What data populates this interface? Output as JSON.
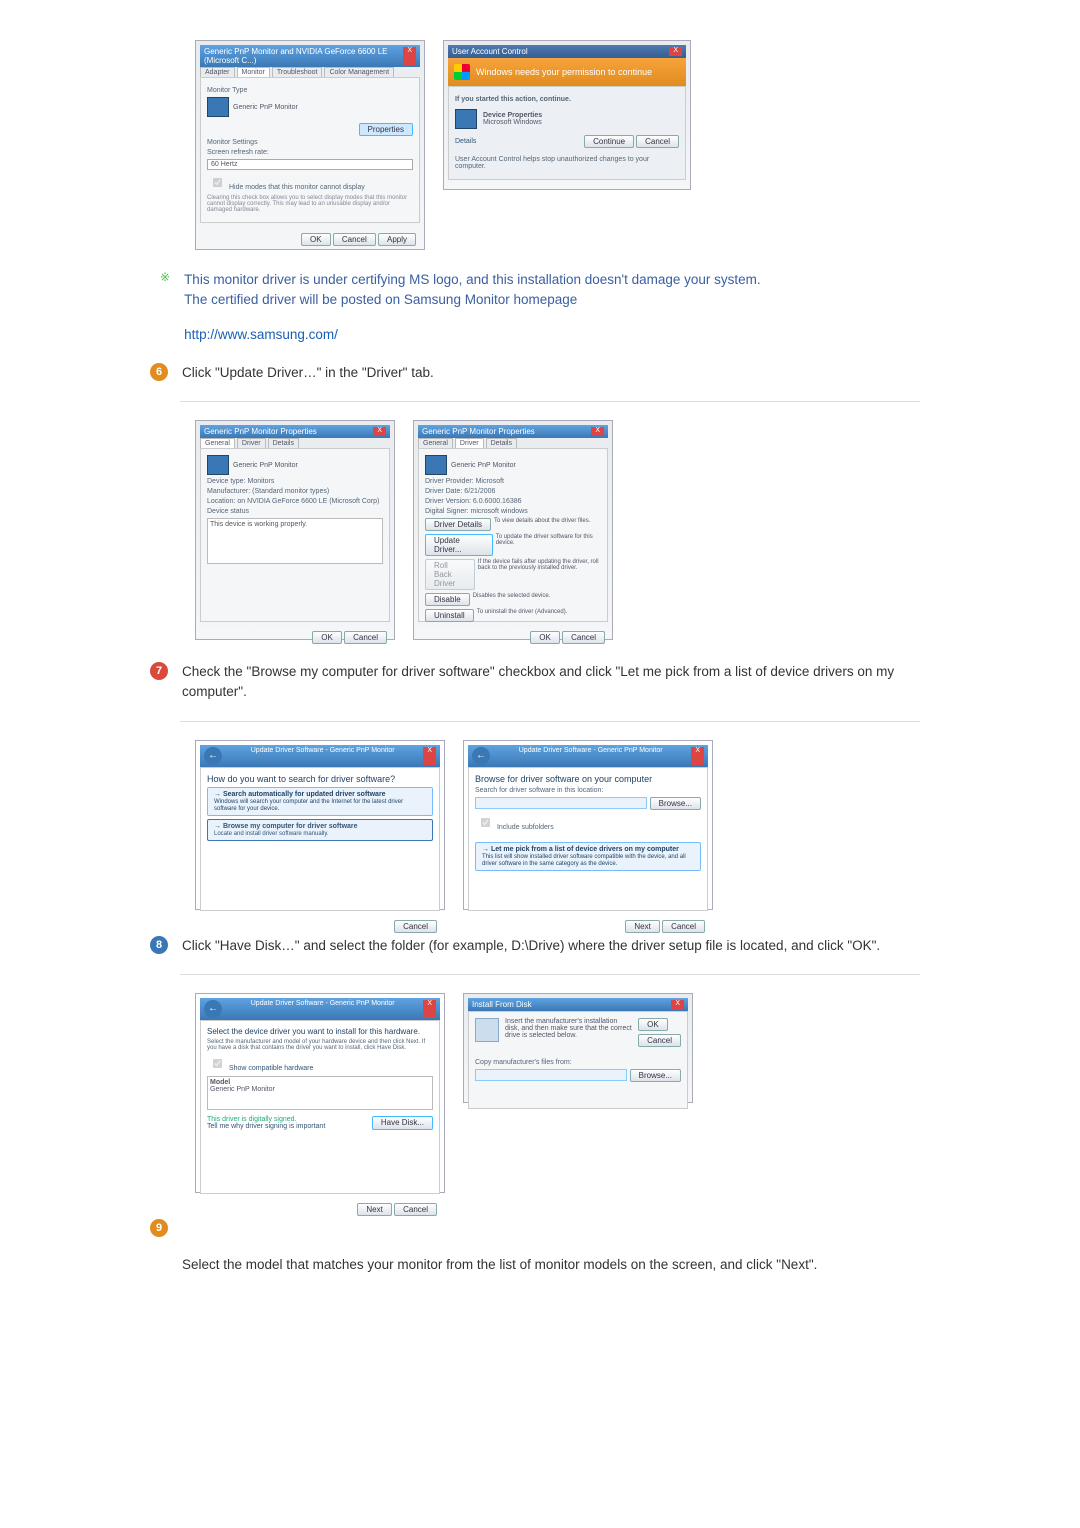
{
  "properties1": {
    "title": "Generic PnP Monitor and NVIDIA GeForce 6600 LE (Microsoft C...)",
    "tabs": [
      "Adapter",
      "Monitor",
      "Troubleshoot",
      "Color Management"
    ],
    "monitor_type_label": "Monitor Type",
    "monitor_type_value": "Generic PnP Monitor",
    "properties_btn": "Properties",
    "monitor_settings_label": "Monitor Settings",
    "refresh_label": "Screen refresh rate:",
    "refresh_value": "60 Hertz",
    "hide_checkbox": "Hide modes that this monitor cannot display",
    "hide_note": "Clearing this check box allows you to select display modes that this monitor cannot display correctly. This may lead to an unusable display and/or damaged hardware.",
    "ok": "OK",
    "cancel": "Cancel",
    "apply": "Apply"
  },
  "uac": {
    "title": "User Account Control",
    "banner": "Windows needs your permission to continue",
    "started_label": "If you started this action, continue.",
    "item_title": "Device Properties",
    "item_pub": "Microsoft Windows",
    "details": "Details",
    "continue": "Continue",
    "cancel": "Cancel",
    "footer": "User Account Control helps stop unauthorized changes to your computer."
  },
  "note": {
    "line1": "This monitor driver is under certifying MS logo, and this installation doesn't damage your system.",
    "line2": "The certified driver will be posted on Samsung Monitor homepage",
    "link": "http://www.samsung.com/"
  },
  "step6": {
    "text": "Click \"Update Driver…\" in the \"Driver\" tab."
  },
  "pnp_general": {
    "title": "Generic PnP Monitor Properties",
    "tabs": [
      "General",
      "Driver",
      "Details"
    ],
    "name": "Generic PnP Monitor",
    "devtype_l": "Device type:",
    "devtype_v": "Monitors",
    "manu_l": "Manufacturer:",
    "manu_v": "(Standard monitor types)",
    "loc_l": "Location:",
    "loc_v": "on NVIDIA GeForce 6600 LE (Microsoft Corp)",
    "status_l": "Device status",
    "status_v": "This device is working properly.",
    "ok": "OK",
    "cancel": "Cancel"
  },
  "pnp_driver": {
    "title": "Generic PnP Monitor Properties",
    "name": "Generic PnP Monitor",
    "provider_l": "Driver Provider:",
    "provider_v": "Microsoft",
    "date_l": "Driver Date:",
    "date_v": "6/21/2006",
    "ver_l": "Driver Version:",
    "ver_v": "6.0.6000.16386",
    "signer_l": "Digital Signer:",
    "signer_v": "microsoft windows",
    "btn_details": "Driver Details",
    "btn_update": "Update Driver...",
    "btn_rollback": "Roll Back Driver",
    "btn_disable": "Disable",
    "btn_uninstall": "Uninstall",
    "d_details": "To view details about the driver files.",
    "d_update": "To update the driver software for this device.",
    "d_rollback": "If the device fails after updating the driver, roll back to the previously installed driver.",
    "d_disable": "Disables the selected device.",
    "d_uninstall": "To uninstall the driver (Advanced).",
    "ok": "OK",
    "cancel": "Cancel"
  },
  "step7": {
    "text": "Check the \"Browse my computer for driver software\" checkbox and click \"Let me pick from a list of device drivers on my computer\"."
  },
  "wizard1": {
    "title": "Update Driver Software - Generic PnP Monitor",
    "heading": "How do you want to search for driver software?",
    "opt1_t": "Search automatically for updated driver software",
    "opt1_d": "Windows will search your computer and the Internet for the latest driver software for your device.",
    "opt2_t": "Browse my computer for driver software",
    "opt2_d": "Locate and install driver software manually.",
    "cancel": "Cancel"
  },
  "wizard2": {
    "title": "Update Driver Software - Generic PnP Monitor",
    "heading": "Browse for driver software on your computer",
    "search_l": "Search for driver software in this location:",
    "browse": "Browse...",
    "include": "Include subfolders",
    "pick_t": "Let me pick from a list of device drivers on my computer",
    "pick_d": "This list will show installed driver software compatible with the device, and all driver software in the same category as the device.",
    "next": "Next",
    "cancel": "Cancel"
  },
  "step8": {
    "text": "Click \"Have Disk…\" and select the folder (for example, D:\\Drive) where the driver setup file is located, and click \"OK\"."
  },
  "wizard3": {
    "title": "Update Driver Software - Generic PnP Monitor",
    "heading": "Select the device driver you want to install for this hardware.",
    "desc": "Select the manufacturer and model of your hardware device and then click Next. If you have a disk that contains the driver you want to install, click Have Disk.",
    "compat": "Show compatible hardware",
    "model_l": "Model",
    "model_v": "Generic PnP Monitor",
    "signed": "This driver is digitally signed.",
    "tell": "Tell me why driver signing is important",
    "have_disk": "Have Disk...",
    "next": "Next",
    "cancel": "Cancel"
  },
  "install_disk": {
    "title": "Install From Disk",
    "instr": "Insert the manufacturer's installation disk, and then make sure that the correct drive is selected below.",
    "ok": "OK",
    "cancel": "Cancel",
    "copy_l": "Copy manufacturer's files from:",
    "browse": "Browse..."
  },
  "step9": {
    "text": "Select the model that matches your monitor from the list of monitor models on the screen, and click \"Next\"."
  }
}
